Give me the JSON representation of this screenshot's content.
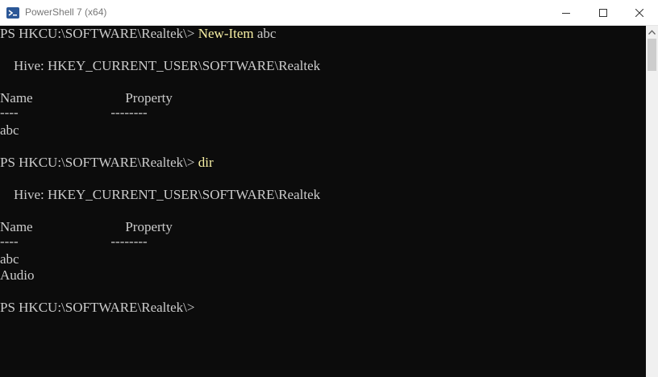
{
  "window": {
    "title": "PowerShell 7 (x64)"
  },
  "console": {
    "lines": {
      "l1": "PS HKCU:\\SOFTWARE\\Realtek\\> ",
      "l1_cmd": "New-Item",
      "l1_arg": " abc",
      "l2": "    Hive: HKEY_CURRENT_USER\\SOFTWARE\\Realtek",
      "l3": "Name                           Property",
      "l4": "----                           --------",
      "l5": "abc",
      "l6": "PS HKCU:\\SOFTWARE\\Realtek\\> ",
      "l6_cmd": "dir",
      "l7": "    Hive: HKEY_CURRENT_USER\\SOFTWARE\\Realtek",
      "l8": "Name                           Property",
      "l9": "----                           --------",
      "l10": "abc",
      "l11": "Audio",
      "l12": "PS HKCU:\\SOFTWARE\\Realtek\\>"
    }
  },
  "colors": {
    "background": "#0c0c0c",
    "text": "#cccccc",
    "command": "#f9f1a5"
  },
  "icons": {
    "app": "powershell-icon",
    "minimize": "minimize-icon",
    "maximize": "maximize-icon",
    "close": "close-icon"
  }
}
